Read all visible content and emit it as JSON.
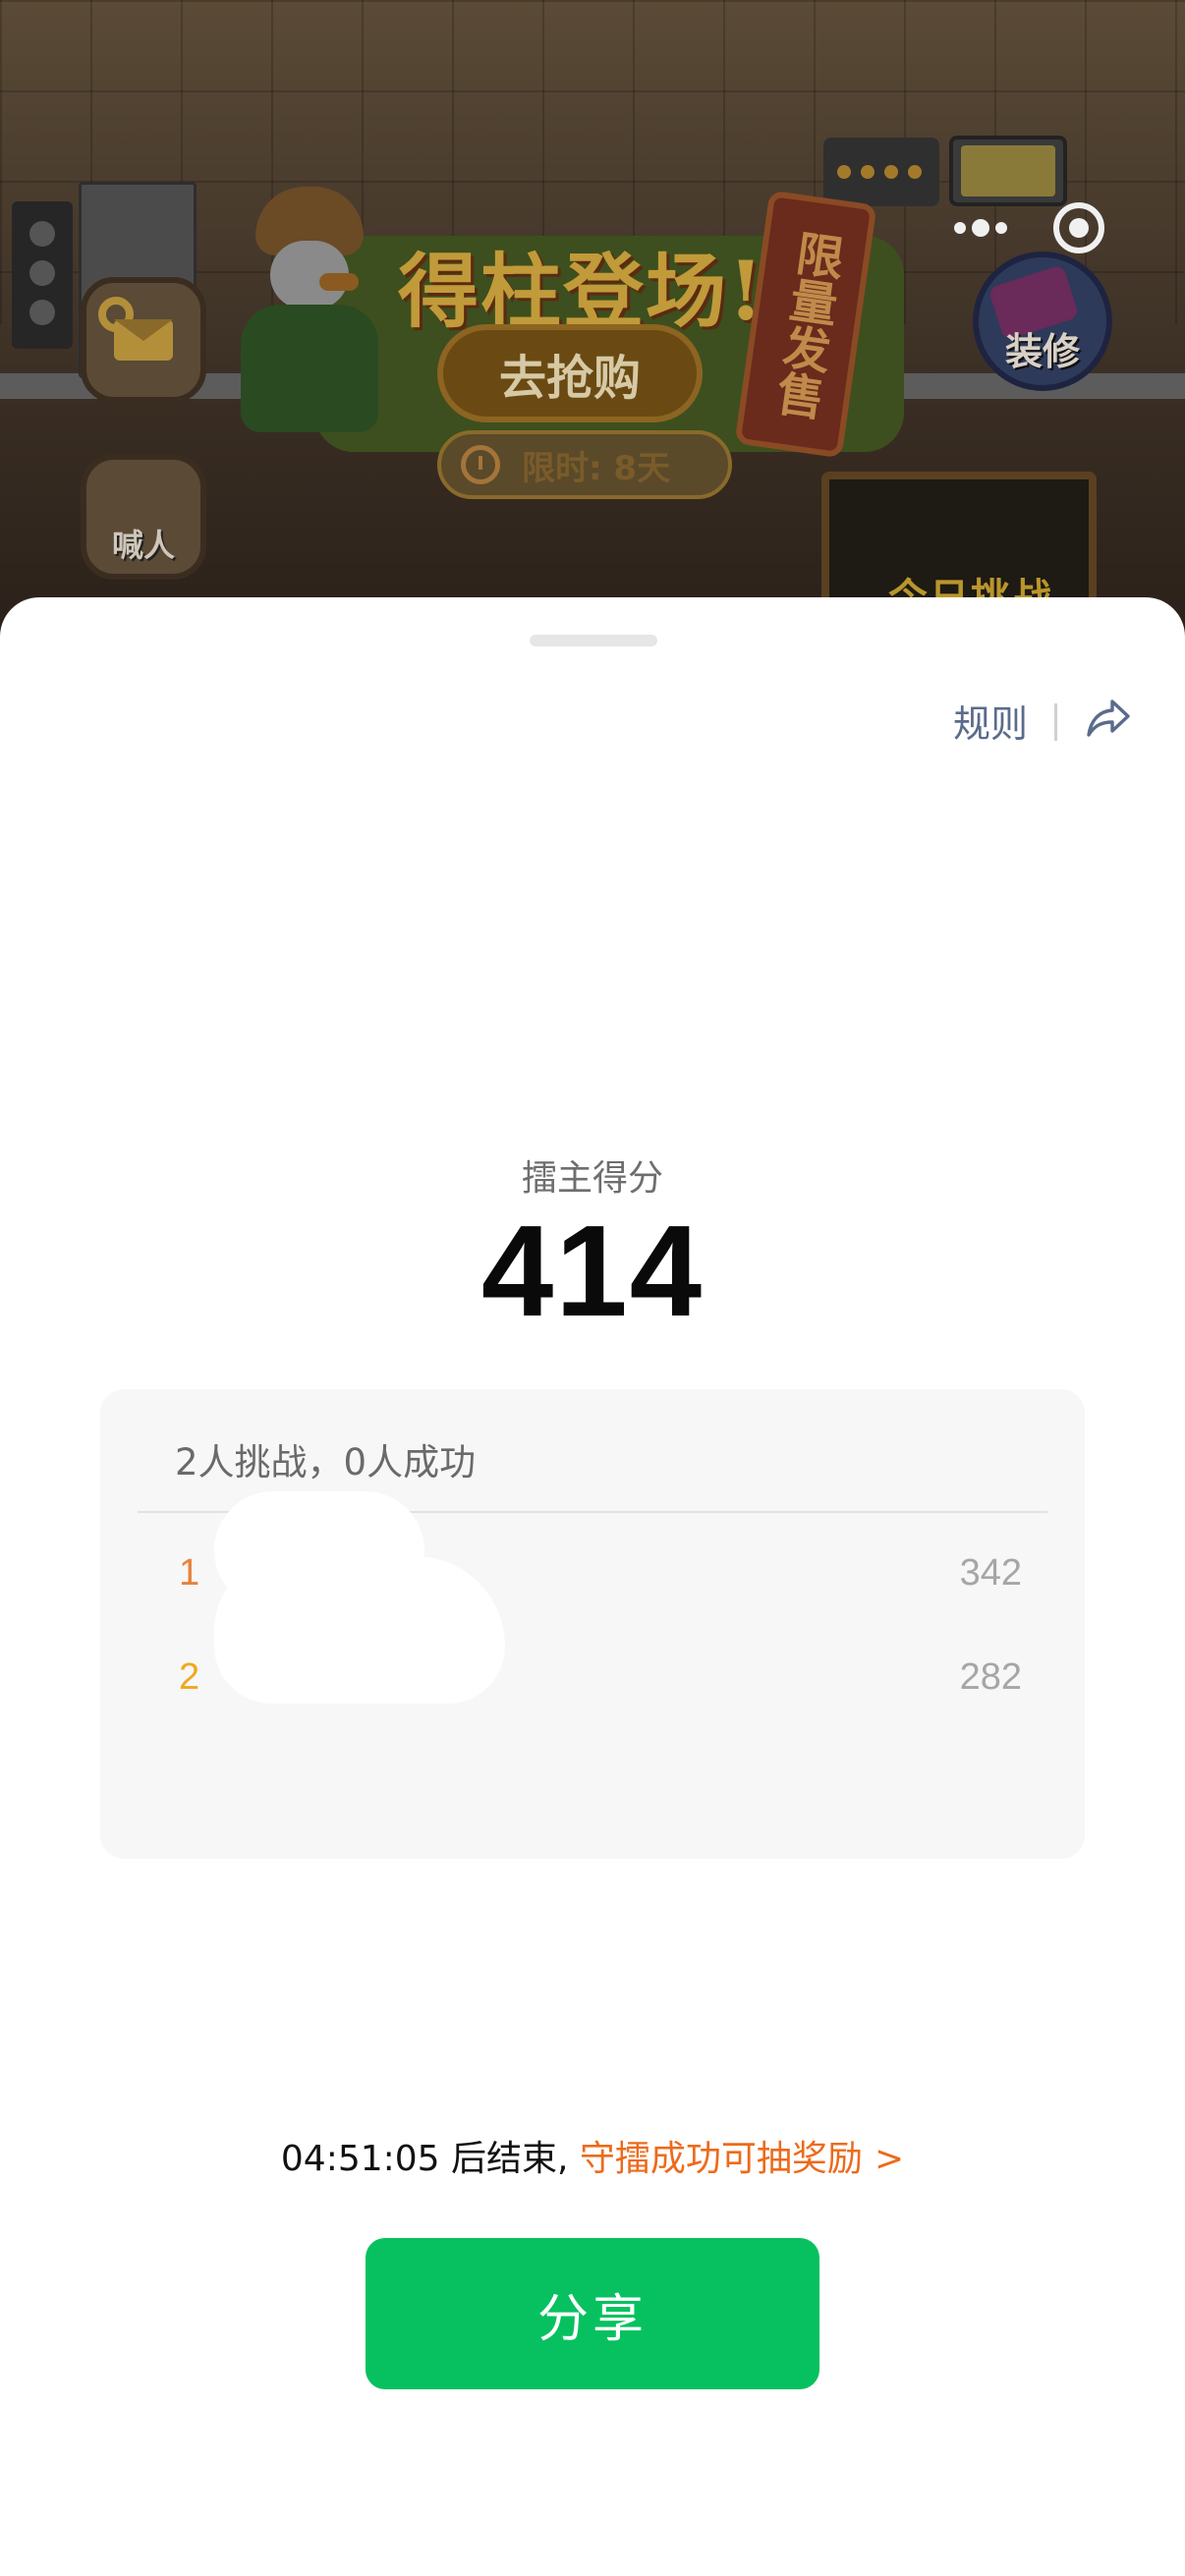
{
  "background_game": {
    "promo_title": "得柱登场!",
    "promo_button": "去抢购",
    "promo_limit": "限时: 8天",
    "promo_tag": "限量发售",
    "settings_mail_button": "",
    "call_button": "喊人",
    "decorate_button": "装修",
    "challenge_board": "今日挑战"
  },
  "capsule": {
    "more_icon": "ellipsis-icon",
    "close_icon": "close-circle-icon"
  },
  "sheet": {
    "rules_label": "规则",
    "share_icon": "share-forward-icon",
    "host_label": "擂主得分",
    "host_score": "414",
    "summary": "2人挑战，0人成功",
    "ranking": [
      {
        "rank": "1",
        "score": "342",
        "color": "#e8823a"
      },
      {
        "rank": "2",
        "score": "282",
        "color": "#f0a81e"
      }
    ],
    "countdown_time": "04:51:05 后结束,",
    "reward_text": "守擂成功可抽奖励",
    "reward_chevron": ">",
    "share_button": "分享"
  },
  "colors": {
    "primary_green": "#07c160",
    "accent_orange": "#ec6b1c",
    "link_gray_blue": "#5b6b8c"
  }
}
